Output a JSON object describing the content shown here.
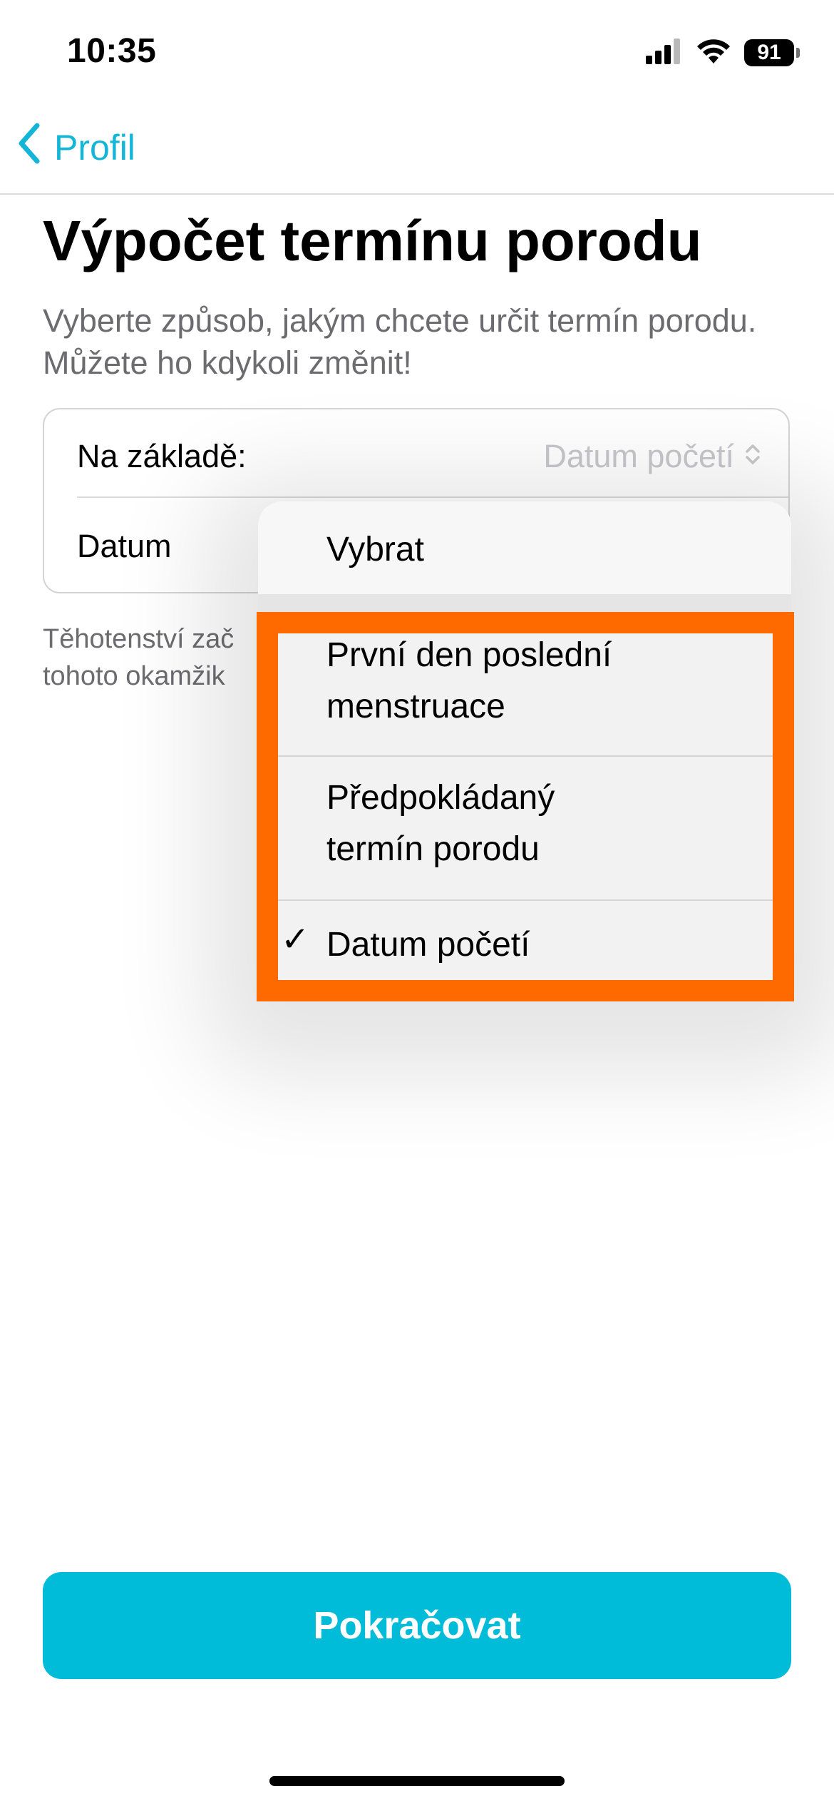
{
  "status_bar": {
    "time": "10:35",
    "battery": "91",
    "icons": [
      "cellular-signal-icon",
      "wifi-icon",
      "battery-icon"
    ]
  },
  "nav": {
    "back_label": "Profil",
    "back_icon": "chevron-left-icon",
    "accent_color": "#14b6d8"
  },
  "page": {
    "title": "Výpočet termínu porodu",
    "subtitle": "Vyberte způsob, jakým chcete určit termín porodu. Můžete ho kdykoli změnit!",
    "hint_line1": "Těhotenství zač",
    "hint_line2": "tohoto okamžik"
  },
  "form": {
    "basis_label": "Na základě:",
    "basis_value": "Datum početí",
    "basis_icon": "chevron-up-down-icon",
    "date_label": "Datum"
  },
  "menu": {
    "title": "Vybrat",
    "options": [
      {
        "label_line1": "První den poslední",
        "label_line2": "menstruace",
        "selected": false
      },
      {
        "label_line1": "Předpokládaný",
        "label_line2": "termín porodu",
        "selected": false
      },
      {
        "label_line1": "Datum početí",
        "label_line2": "",
        "selected": true
      }
    ],
    "check_glyph": "✓",
    "highlight_color": "#ff6a00"
  },
  "footer": {
    "continue_label": "Pokračovat",
    "button_color": "#00bcd8"
  }
}
